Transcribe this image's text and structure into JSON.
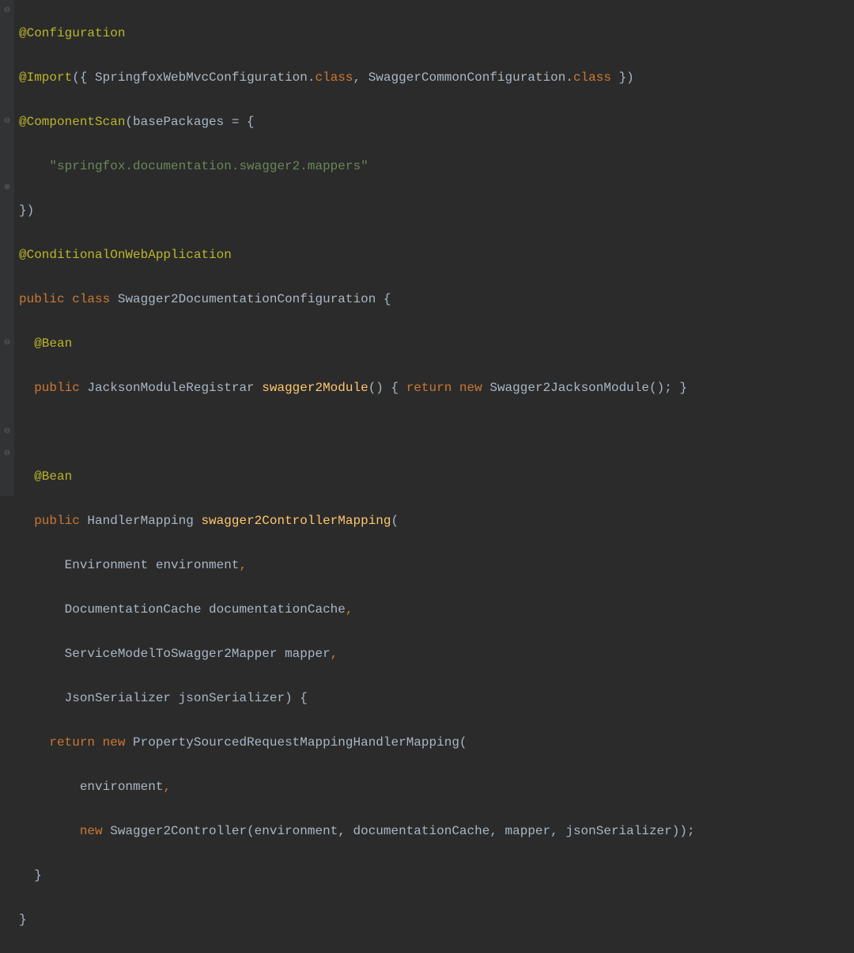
{
  "gutter": {
    "icons": {
      "collapse_open": "⊖",
      "collapse_close": "⊖",
      "expand": "⊕"
    }
  },
  "code": {
    "line1": {
      "ann": "@Configuration"
    },
    "line2": {
      "ann": "@Import",
      "lp": "({ ",
      "c1": "SpringfoxWebMvcConfiguration",
      "dot1": ".",
      "kw1": "class",
      "comma": ", ",
      "c2": "SwaggerCommonConfiguration",
      "dot2": ".",
      "kw2": "class",
      "rp": " })"
    },
    "line3": {
      "ann": "@ComponentScan",
      "lp": "(",
      "attr": "basePackages",
      "eq": " = {"
    },
    "line4": {
      "indent": "    ",
      "str": "\"springfox.documentation.swagger2.mappers\""
    },
    "line5": {
      "rp": "})"
    },
    "line6": {
      "ann": "@ConditionalOnWebApplication"
    },
    "line7": {
      "kw1": "public",
      "sp1": " ",
      "kw2": "class",
      "sp2": " ",
      "name": "Swagger2DocumentationConfiguration",
      "lb": " {"
    },
    "line8": {
      "indent": "  ",
      "ann": "@Bean"
    },
    "line9": {
      "indent": "  ",
      "kw1": "public",
      "sp1": " ",
      "type": "JacksonModuleRegistrar",
      "sp2": " ",
      "method": "swagger2Module",
      "paren": "()",
      "sp3": " { ",
      "kw2": "return",
      "sp4": " ",
      "kw3": "new",
      "sp5": " ",
      "ctor": "Swagger2JacksonModule",
      "tail": "(); }"
    },
    "line10": {
      "blank": ""
    },
    "line11": {
      "indent": "  ",
      "ann": "@Bean"
    },
    "line12": {
      "indent": "  ",
      "kw1": "public",
      "sp1": " ",
      "type": "HandlerMapping",
      "sp2": " ",
      "method": "swagger2ControllerMapping",
      "lp": "("
    },
    "line13": {
      "indent": "      ",
      "type": "Environment",
      "sp": " ",
      "name": "environment",
      "comma": ","
    },
    "line14": {
      "indent": "      ",
      "type": "DocumentationCache",
      "sp": " ",
      "name": "documentationCache",
      "comma": ","
    },
    "line15": {
      "indent": "      ",
      "type": "ServiceModelToSwagger2Mapper",
      "sp": " ",
      "name": "mapper",
      "comma": ","
    },
    "line16": {
      "indent": "      ",
      "type": "JsonSerializer",
      "sp": " ",
      "name": "jsonSerializer",
      "rp": ") {"
    },
    "line17": {
      "indent": "    ",
      "kw1": "return",
      "sp1": " ",
      "kw2": "new",
      "sp2": " ",
      "ctor": "PropertySourcedRequestMappingHandlerMapping",
      "lp": "("
    },
    "line18": {
      "indent": "        ",
      "name": "environment",
      "comma": ","
    },
    "line19": {
      "indent": "        ",
      "kw": "new",
      "sp": " ",
      "ctor": "Swagger2Controller",
      "lp": "(",
      "args": "environment, documentationCache, mapper, jsonSerializer",
      "rp": "));"
    },
    "line20": {
      "indent": "  ",
      "rb": "}"
    },
    "line21": {
      "rb": "}"
    }
  }
}
